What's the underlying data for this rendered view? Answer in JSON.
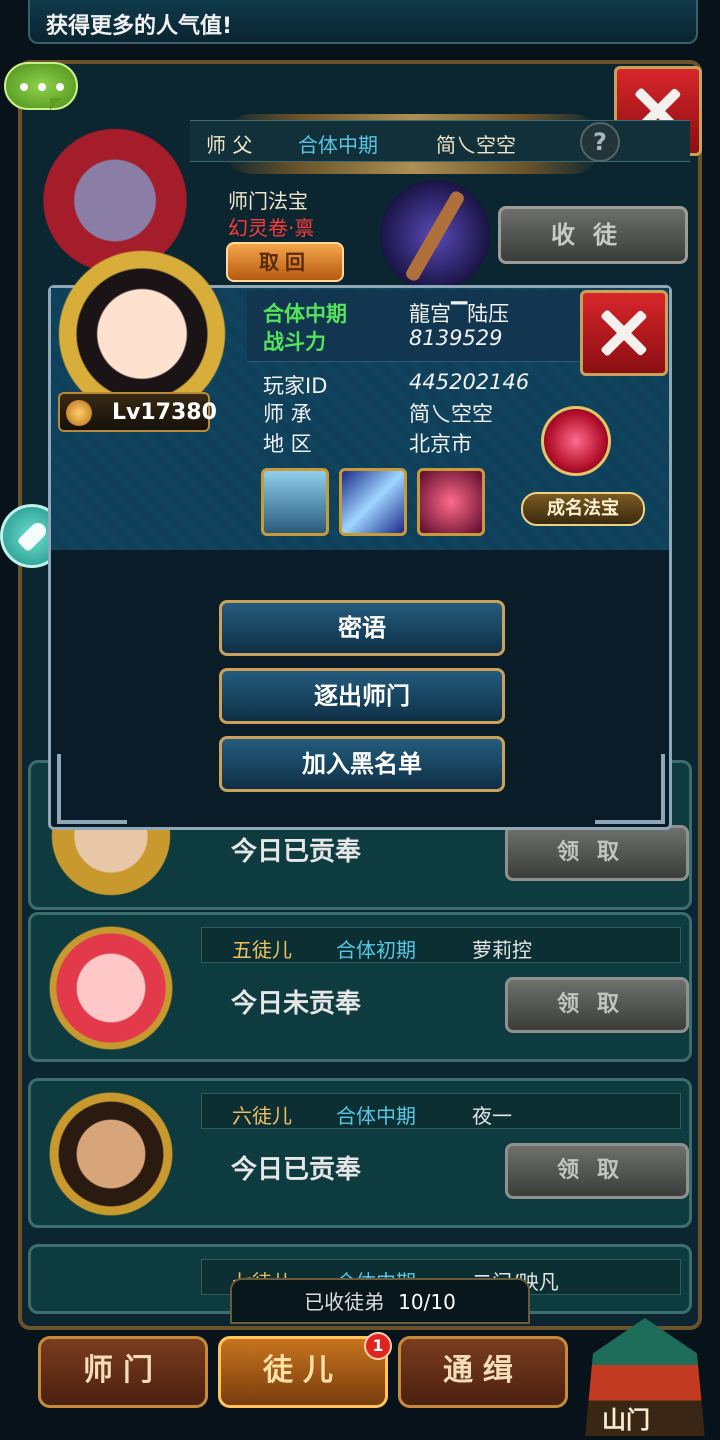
{
  "banner": {
    "text": "获得更多的人气值!"
  },
  "master_section": {
    "role": "师  父",
    "realm": "合体中期",
    "name": "简乀空空",
    "treasure_label": "师门法宝",
    "treasure_name": "幻灵卷·禀",
    "retrieve_label": "取回",
    "recruit_label": "收徒"
  },
  "popup": {
    "realm": "合体中期",
    "player_name": "龍宫▔陆压",
    "power_label": "战斗力",
    "power_value": "8139529",
    "id_label": "玩家ID",
    "id_value": "445202146",
    "lineage_label": "师  承",
    "lineage_value": "简乀空空",
    "region_label": "地  区",
    "region_value": "北京市",
    "famous_treasure_label": "成名法宝",
    "level": "Lv17380",
    "buttons": [
      "密语",
      "逐出师门",
      "加入黑名单"
    ]
  },
  "disciples": [
    {
      "status": "今日已贡奉",
      "claim_label": "领取"
    },
    {
      "rank": "五徒儿",
      "realm": "合体初期",
      "name": "萝莉控",
      "status": "今日未贡奉",
      "claim_label": "领取"
    },
    {
      "rank": "六徒儿",
      "realm": "合体中期",
      "name": "夜一",
      "status": "今日已贡奉",
      "claim_label": "领取"
    },
    {
      "rank": "七徒儿",
      "realm": "合体中期",
      "name": "二门/映凡"
    }
  ],
  "counter": {
    "label": "已收徒弟",
    "value": "10/10"
  },
  "tabs": [
    "师门",
    "徒儿",
    "通缉"
  ],
  "tab_badge": "1",
  "gate_label": "山门",
  "colors": {
    "green_text": "#54e35a",
    "red_text": "#ff3b3b",
    "gold_border": "#caa15a",
    "teal_row": "#0e3b3f"
  }
}
